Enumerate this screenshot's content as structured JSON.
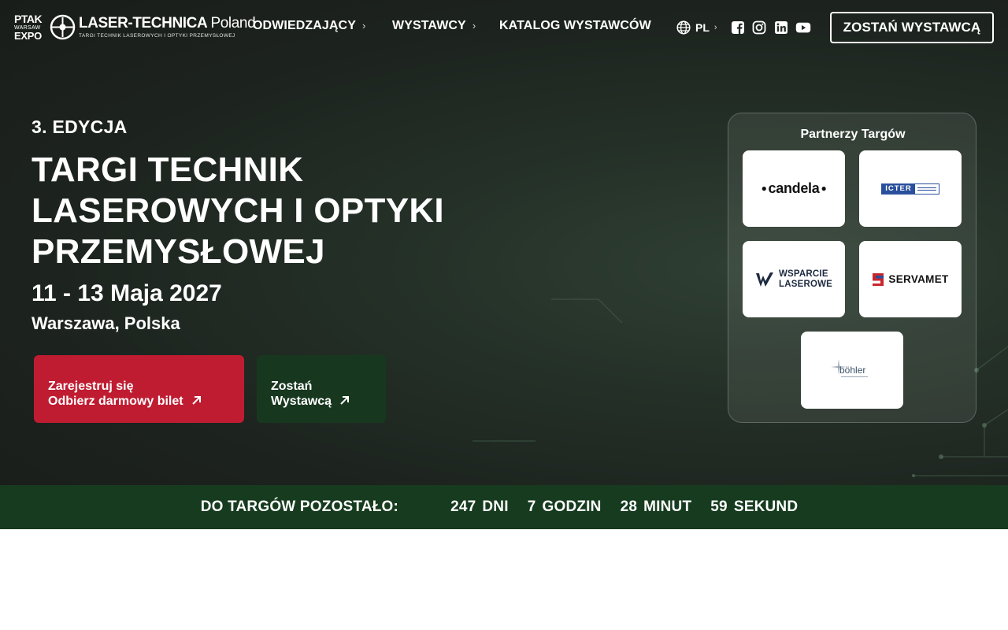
{
  "header": {
    "logo_ptak": {
      "line1": "PTAK",
      "line2": "WARSAW",
      "line3": "EXPO"
    },
    "logo_brand": {
      "name": "LASER-TECHNICA",
      "country": "Poland",
      "tagline": "TARGI TECHNIK LASEROWYCH I OPTYKI PRZEMYSŁOWEJ"
    },
    "nav": [
      {
        "label": "ODWIEDZAJĄCY",
        "icon": "chevron-right-icon"
      },
      {
        "label": "WYSTAWCY",
        "icon": "chevron-right-icon"
      },
      {
        "label": "KATALOG WYSTAWCÓW"
      }
    ],
    "language": {
      "label": "PL",
      "icon": "globe-icon"
    },
    "social": [
      "facebook-icon",
      "instagram-icon",
      "linkedin-icon",
      "youtube-icon"
    ],
    "cta_label": "ZOSTAŃ WYSTAWCĄ"
  },
  "hero": {
    "edition": "3. EDYCJA",
    "title": "TARGI TECHNIK LASEROWYCH I OPTYKI PRZEMYSŁOWEJ",
    "dates": "11 - 13 Maja 2027",
    "location": "Warszawa, Polska",
    "register_button": {
      "line1": "Zarejestruj się",
      "line2": "Odbierz darmowy bilet"
    },
    "exhibitor_button": {
      "line1": "Zostań",
      "line2": "Wystawcą"
    }
  },
  "partners": {
    "title": "Partnerzy Targów",
    "logos": [
      {
        "name": "candela",
        "text": "candela"
      },
      {
        "name": "icter",
        "text": "ICTER"
      },
      {
        "name": "wsparcie-laserowe",
        "line1": "WSPARCIE",
        "line2": "LASEROWE"
      },
      {
        "name": "servamet",
        "text": "SERVAMET"
      },
      {
        "name": "bohler",
        "text": "böhler"
      }
    ]
  },
  "countdown": {
    "label": "DO TARGÓW POZOSTAŁO:",
    "days": {
      "value": "247",
      "unit": "DNI"
    },
    "hours": {
      "value": "7",
      "unit": "GODZIN"
    },
    "minutes": {
      "value": "28",
      "unit": "MINUT"
    },
    "seconds": {
      "value": "59",
      "unit": "SEKUND"
    }
  },
  "colors": {
    "hero_bg": "#1f2622",
    "register_red": "#c01c31",
    "exhibitor_green": "#17381f",
    "countdown_green": "#163b1e"
  }
}
